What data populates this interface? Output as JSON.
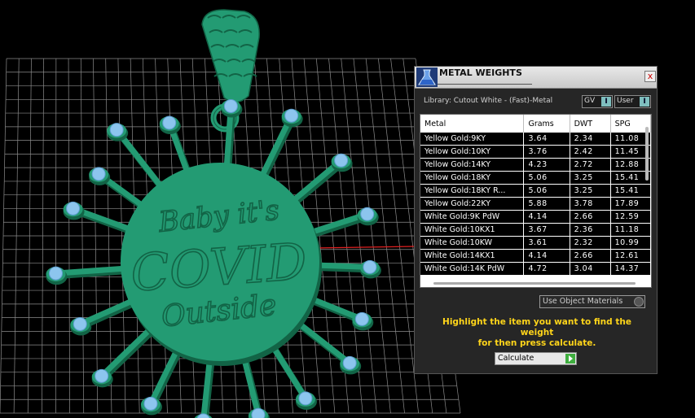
{
  "panel": {
    "title": "METAL WEIGHTS",
    "close_label": "x",
    "library_label": "Library: Cutout White - (Fast)-Metal",
    "toggles": [
      {
        "label": "GV",
        "value": "I"
      },
      {
        "label": "User",
        "value": "I"
      }
    ],
    "table": {
      "headers": [
        "Metal",
        "Grams",
        "DWT",
        "SPG"
      ],
      "rows": [
        [
          "Yellow Gold:9KY",
          "3.64",
          "2.34",
          "11.08"
        ],
        [
          "Yellow Gold:10KY",
          "3.76",
          "2.42",
          "11.45"
        ],
        [
          "Yellow Gold:14KY",
          "4.23",
          "2.72",
          "12.88"
        ],
        [
          "Yellow Gold:18KY",
          "5.06",
          "3.25",
          "15.41"
        ],
        [
          "Yellow Gold:18KY R...",
          "5.06",
          "3.25",
          "15.41"
        ],
        [
          "Yellow Gold:22KY",
          "5.88",
          "3.78",
          "17.89"
        ],
        [
          "White Gold:9K PdW",
          "4.14",
          "2.66",
          "12.59"
        ],
        [
          "White Gold:10KX1",
          "3.67",
          "2.36",
          "11.18"
        ],
        [
          "White Gold:10KW",
          "3.61",
          "2.32",
          "10.99"
        ],
        [
          "White Gold:14KX1",
          "4.14",
          "2.66",
          "12.61"
        ],
        [
          "White Gold:14K PdW",
          "4.72",
          "3.04",
          "14.37"
        ]
      ]
    },
    "use_object_materials_label": "Use Object Materials",
    "instruction_line1": "Highlight the item you want to find the weight",
    "instruction_line2": "for then press calculate.",
    "calculate_label": "Calculate"
  },
  "model": {
    "engraving_line1": "Baby it's",
    "engraving_line2": "COVID",
    "engraving_line3": "Outside",
    "colors": {
      "metal": "#239b73",
      "metal_dark": "#126446",
      "stone": "#8cc5ee",
      "grid": "#8c8c8c",
      "axis": "#e02020"
    }
  },
  "icons": {
    "app_logo": "flask-logo-icon",
    "close": "close-icon",
    "calculate": "play-arrow-icon"
  }
}
